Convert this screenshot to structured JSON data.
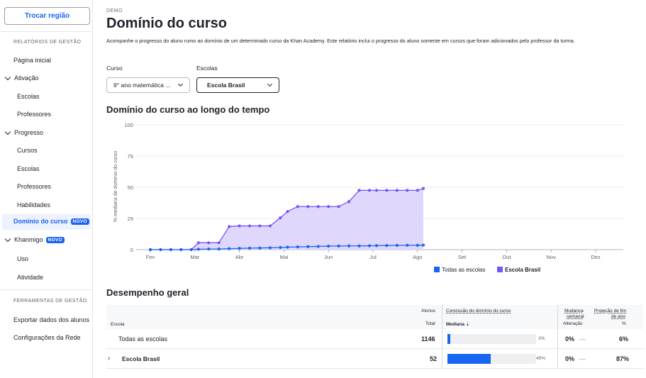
{
  "sidebar": {
    "region_button": "Trocar região",
    "section_management_reports": "RELATÓRIOS DE GESTÃO",
    "home": "Página inicial",
    "activation": "Ativação",
    "activation_schools": "Escolas",
    "activation_teachers": "Professores",
    "progress": "Progresso",
    "progress_courses": "Cursos",
    "progress_schools": "Escolas",
    "progress_teachers": "Professores",
    "progress_skills": "Habilidades",
    "course_mastery": "Domínio do curso",
    "course_mastery_badge": "NOVO",
    "khanmigo": "Khanmigo",
    "khanmigo_badge": "NOVO",
    "khanmigo_usage": "Uso",
    "khanmigo_activity": "Atividade",
    "section_management_tools": "FERRAMENTAS DE GESTÃO",
    "export_data": "Exportar dados dos alunos",
    "network_settings": "Configurações da Rede"
  },
  "header": {
    "demo": "DEMO",
    "title": "Domínio do curso",
    "description": "Acompanhe o progresso do aluno rumo ao domínio de um determinado curso da Khan Academy. Este relatório inclui o progresso do aluno somente em cursos que foram adicionados pelo professor da turma."
  },
  "filters": {
    "course_label": "Curso",
    "course_value": "9° ano matemática ...",
    "schools_label": "Escolas",
    "schools_value": "Escola Brasil"
  },
  "chart_section_title": "Domínio do curso ao longo do tempo",
  "chart_data": {
    "type": "area",
    "ylabel": "% mediana de domínio do curso",
    "ylim": [
      0,
      100
    ],
    "yticks": [
      "0",
      "25",
      "50",
      "75",
      "100"
    ],
    "months": [
      "Fev",
      "Mar",
      "Abr",
      "Mai",
      "Jun",
      "Jul",
      "Ago",
      "Set",
      "Out",
      "Nov",
      "Dez"
    ],
    "x": [
      2.0,
      2.23,
      2.46,
      2.69,
      2.92,
      3.08,
      3.31,
      3.54,
      3.77,
      4.0,
      4.23,
      4.46,
      4.69,
      4.92,
      5.08,
      5.31,
      5.54,
      5.77,
      6.0,
      6.23,
      6.46,
      6.69,
      6.92,
      7.08,
      7.31,
      7.54,
      7.77,
      8.0,
      8.13
    ],
    "grid": true,
    "legend_position": "bottom",
    "series": [
      {
        "name": "Todas as escolas",
        "color": "#1865f2",
        "values": [
          0,
          0,
          0,
          0,
          0,
          0.3,
          0.5,
          0.5,
          0.8,
          1.0,
          1.2,
          1.3,
          1.5,
          1.7,
          2.0,
          2.2,
          2.4,
          2.6,
          2.8,
          2.9,
          3.0,
          3.0,
          3.1,
          3.2,
          3.3,
          3.4,
          3.5,
          3.5,
          3.6
        ]
      },
      {
        "name": "Escola Brasil",
        "color": "#7854f7",
        "fill": "#ddd3fc",
        "values": [
          0,
          0,
          0,
          0,
          0,
          5.5,
          5.5,
          5.5,
          18.5,
          19,
          19,
          19,
          19,
          25.5,
          30.5,
          34.5,
          34.5,
          34.5,
          34.5,
          34.5,
          38.5,
          47.5,
          47.5,
          47.5,
          47.5,
          47.5,
          47.5,
          47.5,
          49
        ]
      }
    ]
  },
  "performance": {
    "title": "Desempenho geral",
    "headers": {
      "school": "Escola",
      "students_top": "Alunos",
      "students_bottom": "Total",
      "mastery_top": "Conclusão do domínio do curso",
      "mastery_bottom": "Mediana",
      "change_top1": "Mudança",
      "change_top2": "semanal",
      "change_bottom": "Alteração",
      "projection_top1": "Projeção de fim",
      "projection_top2": "de ano",
      "projection_bottom": "%"
    },
    "rows": [
      {
        "school": "Todas as escolas",
        "students": "1146",
        "median_pct": 3,
        "median_label": "3%",
        "change": "0%",
        "change_dash": "—",
        "projection": "6%"
      },
      {
        "school": "Escola Brasil",
        "students": "52",
        "median_pct": 49,
        "median_label": "49%",
        "change": "0%",
        "change_dash": "—",
        "projection": "87%"
      }
    ]
  }
}
